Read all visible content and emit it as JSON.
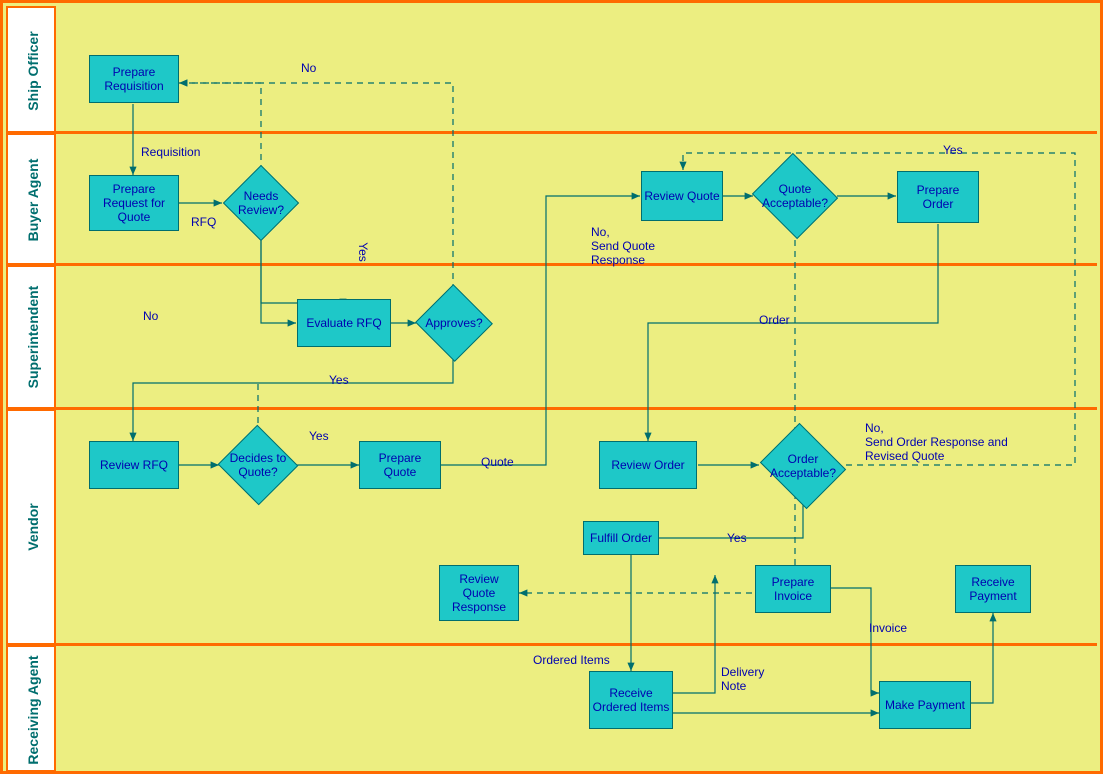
{
  "lanes": {
    "ship_officer": "Ship Officer",
    "buyer_agent": "Buyer Agent",
    "superintendent": "Superintendent",
    "vendor": "Vendor",
    "receiving_agent": "Receiving Agent"
  },
  "boxes": {
    "prepare_requisition": "Prepare Requisition",
    "prepare_rfq": "Prepare Request for Quote",
    "review_quote": "Review Quote",
    "prepare_order": "Prepare Order",
    "evaluate_rfq": "Evaluate RFQ",
    "review_rfq": "Review RFQ",
    "prepare_quote": "Prepare Quote",
    "review_order": "Review Order",
    "fulfill_order": "Fulfill Order",
    "review_quote_response": "Review Quote Response",
    "prepare_invoice": "Prepare Invoice",
    "receive_payment": "Receive Payment",
    "receive_ordered_items": "Receive Ordered Items",
    "make_payment": "Make Payment"
  },
  "decisions": {
    "needs_review": "Needs Review?",
    "approves": "Approves?",
    "decides_to_quote": "Decides to Quote?",
    "quote_acceptable": "Quote Acceptable?",
    "order_acceptable": "Order Acceptable?"
  },
  "labels": {
    "no": "No",
    "requisition": "Requisition",
    "rfq": "RFQ",
    "yes": "Yes",
    "no_send_quote_response": "No,\nSend Quote\nResponse",
    "order": "Order",
    "quote": "Quote",
    "no_send_order_response": "No,\nSend Order Response and\nRevised Quote",
    "invoice": "Invoice",
    "ordered_items": "Ordered Items",
    "delivery_note": "Delivery\nNote"
  }
}
